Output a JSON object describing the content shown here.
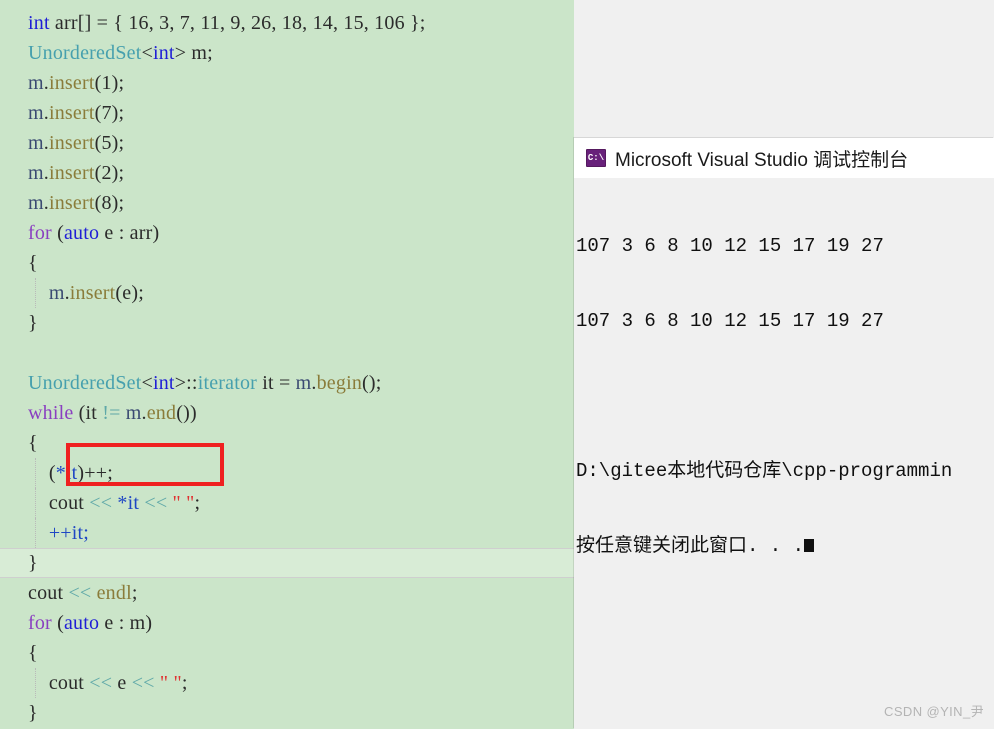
{
  "editor": {
    "background_color": "#cbe5c9",
    "current_line_color": "#d8ecd6",
    "lines": [
      {
        "id": 1,
        "text": "int arr[] = { 16, 3, 7, 11, 9, 26, 18, 14, 15, 106 };"
      },
      {
        "id": 2,
        "text": "UnorderedSet<int> m;"
      },
      {
        "id": 3,
        "text": "m.insert(1);"
      },
      {
        "id": 4,
        "text": "m.insert(7);"
      },
      {
        "id": 5,
        "text": "m.insert(5);"
      },
      {
        "id": 6,
        "text": "m.insert(2);"
      },
      {
        "id": 7,
        "text": "m.insert(8);"
      },
      {
        "id": 8,
        "text": "for (auto e : arr)"
      },
      {
        "id": 9,
        "text": "{"
      },
      {
        "id": 10,
        "text": "    m.insert(e);"
      },
      {
        "id": 11,
        "text": "}"
      },
      {
        "id": 12,
        "text": ""
      },
      {
        "id": 13,
        "text": "UnorderedSet<int>::iterator it = m.begin();"
      },
      {
        "id": 14,
        "text": "while (it != m.end())"
      },
      {
        "id": 15,
        "text": "{"
      },
      {
        "id": 16,
        "text": "    (*it)++;"
      },
      {
        "id": 17,
        "text": "    cout << *it << \" \";"
      },
      {
        "id": 18,
        "text": "    ++it;"
      },
      {
        "id": 19,
        "text": "}"
      },
      {
        "id": 20,
        "text": "cout << endl;"
      },
      {
        "id": 21,
        "text": "for (auto e : m)"
      },
      {
        "id": 22,
        "text": "{"
      },
      {
        "id": 23,
        "text": "    cout << e << \" \";"
      },
      {
        "id": 24,
        "text": "}"
      }
    ],
    "tokens": {
      "l1": {
        "t1": "int",
        "t2": " arr[] = { 16, 3, 7, 11, 9, 26, 18, 14, 15, 106 };"
      },
      "l2": {
        "t1": "UnorderedSet",
        "t2": "<",
        "t3": "int",
        "t4": "> m;"
      },
      "l3": {
        "obj": "m",
        "dot": ".",
        "fn": "insert",
        "arg": "(1);"
      },
      "l4": {
        "obj": "m",
        "dot": ".",
        "fn": "insert",
        "arg": "(7);"
      },
      "l5": {
        "obj": "m",
        "dot": ".",
        "fn": "insert",
        "arg": "(5);"
      },
      "l6": {
        "obj": "m",
        "dot": ".",
        "fn": "insert",
        "arg": "(2);"
      },
      "l7": {
        "obj": "m",
        "dot": ".",
        "fn": "insert",
        "arg": "(8);"
      },
      "l8": {
        "kw": "for",
        "mid": " (",
        "type": "auto",
        "rest": " e : arr)"
      },
      "l9": {
        "brace": "{"
      },
      "l10": {
        "obj": "m",
        "dot": ".",
        "fn": "insert",
        "arg": "(e);"
      },
      "l11": {
        "brace": "}"
      },
      "l13": {
        "cls": "UnorderedSet",
        "lt": "<",
        "type": "int",
        "gt": ">::",
        "it": "iterator",
        "mid": " it = ",
        "obj": "m",
        "dot": ".",
        "fn": "begin",
        "arg": "();"
      },
      "l14": {
        "kw": "while",
        "p1": " (it ",
        "op": "!=",
        "p2": " ",
        "obj": "m",
        "dot": ".",
        "fn": "end",
        "arg": "())"
      },
      "l15": {
        "brace": "{"
      },
      "l16": {
        "expr": "(",
        "star": "*it",
        "rest": ")++;"
      },
      "l17": {
        "cout": "cout ",
        "op1": "<<",
        "star": " *it ",
        "op2": "<<",
        "sp": " ",
        "str": "\" \"",
        "end": ";"
      },
      "l18": {
        "inc": "++it;"
      },
      "l19": {
        "brace": "}"
      },
      "l20": {
        "cout": "cout ",
        "op": "<<",
        "sp": " ",
        "fn": "endl",
        "end": ";"
      },
      "l21": {
        "kw": "for",
        "mid": " (",
        "type": "auto",
        "rest": " e : m)"
      },
      "l22": {
        "brace": "{"
      },
      "l23": {
        "cout": "cout ",
        "op1": "<<",
        "e": " e ",
        "op2": "<<",
        "sp": " ",
        "str": "\" \"",
        "end": ";"
      },
      "l24": {
        "brace": "}"
      }
    },
    "annotation": {
      "shape": "rectangle",
      "color": "#ef2020",
      "targets_line": "(*it)++;"
    }
  },
  "console": {
    "icon": "console-window-icon",
    "icon_glyph": "C:\\",
    "title": "Microsoft Visual Studio 调试控制台",
    "lines": [
      "107 3 6 8 10 12 15 17 19 27",
      "107 3 6 8 10 12 15 17 19 27",
      "",
      "D:\\gitee本地代码仓库\\cpp-programmin",
      "按任意键关闭此窗口. . ."
    ]
  },
  "watermark": {
    "text": "CSDN @YIN_尹"
  }
}
